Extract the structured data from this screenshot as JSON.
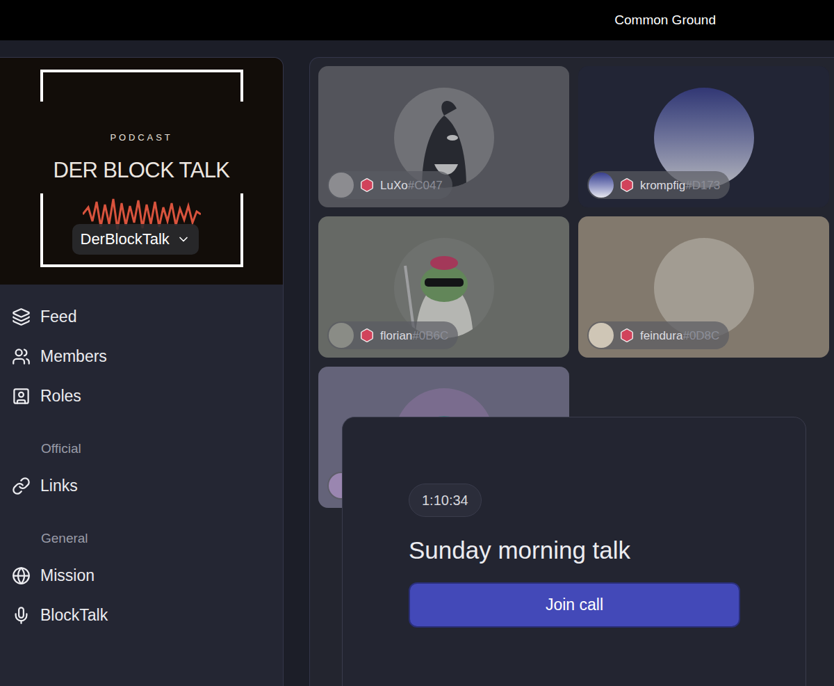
{
  "topbar": {
    "title": "Common Ground"
  },
  "community": {
    "name": "DerBlockTalk",
    "banner": {
      "kicker": "PODCAST",
      "title": "DER BLOCK TALK"
    }
  },
  "sidebar": {
    "items": [
      {
        "kind": "item",
        "label": "Feed"
      },
      {
        "kind": "item",
        "label": "Members"
      },
      {
        "kind": "item",
        "label": "Roles"
      },
      {
        "kind": "section",
        "label": "Official"
      },
      {
        "kind": "item",
        "label": "Links"
      },
      {
        "kind": "section",
        "label": "General"
      },
      {
        "kind": "item",
        "label": "Mission"
      },
      {
        "kind": "item",
        "label": "BlockTalk"
      }
    ]
  },
  "tiles": [
    {
      "name": "LuXo",
      "tag": "#C047"
    },
    {
      "name": "krompfig",
      "tag": "#D173"
    },
    {
      "name": "florian",
      "tag": "#0B6C"
    },
    {
      "name": "feindura",
      "tag": "#0D8C"
    },
    {}
  ],
  "call": {
    "duration": "1:10:34",
    "title": "Sunday morning talk",
    "button": "Join call"
  }
}
